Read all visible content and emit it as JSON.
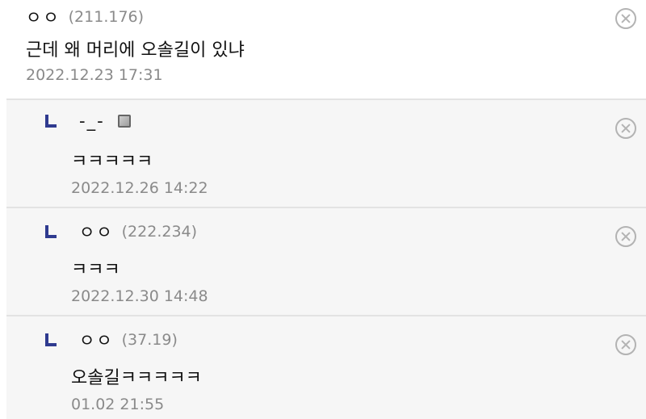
{
  "comments": [
    {
      "nick": "ㅇㅇ",
      "ip": "(211.176)",
      "content": "근데 왜 머리에 오솔길이 있냐",
      "date": "2022.12.23 17:31",
      "delete_icon": "close-circle-icon"
    }
  ],
  "replies": [
    {
      "nick": "-_-",
      "ip": "",
      "fixed_badge_icon": "fixed-nick-badge-icon",
      "content": "ㅋㅋㅋㅋㅋ",
      "date": "2022.12.26 14:22",
      "delete_icon": "close-circle-icon"
    },
    {
      "nick": "ㅇㅇ",
      "ip": "(222.234)",
      "content": "ㅋㅋㅋ",
      "date": "2022.12.30 14:48",
      "delete_icon": "close-circle-icon"
    },
    {
      "nick": "ㅇㅇ",
      "ip": "(37.19)",
      "content": "오솔길ㅋㅋㅋㅋㅋ",
      "date": "01.02 21:55",
      "delete_icon": "close-circle-icon"
    }
  ],
  "colors": {
    "reply_marker": "#2f3a8f",
    "meta_text": "#8a8a8a",
    "reply_background": "#f6f6f6"
  }
}
